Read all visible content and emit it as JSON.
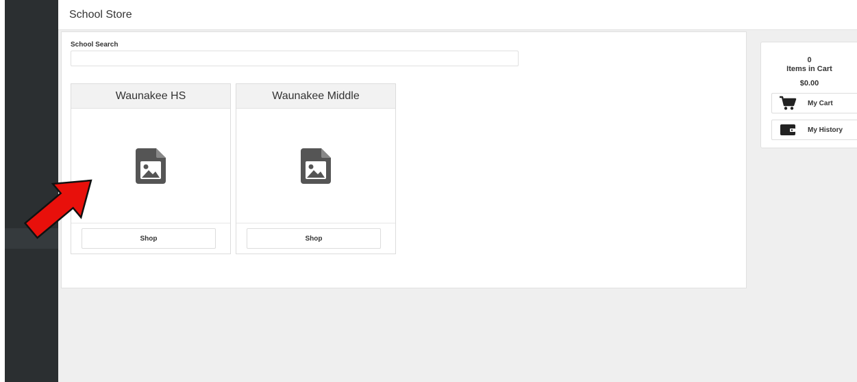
{
  "header": {
    "title": "School Store"
  },
  "search": {
    "label": "School Search",
    "value": "",
    "placeholder": ""
  },
  "schools": [
    {
      "name": "Waunakee HS",
      "button": "Shop",
      "image_icon": "image-file-icon"
    },
    {
      "name": "Waunakee Middle",
      "button": "Shop",
      "image_icon": "image-file-icon"
    }
  ],
  "cart": {
    "count": "0",
    "label": "Items in Cart",
    "total": "$0.00",
    "my_cart": "My Cart",
    "my_history": "My History"
  },
  "annotation": {
    "icon": "red-arrow-icon",
    "color": "#e8100b"
  },
  "colors": {
    "sidebar": "#2b2f31",
    "background": "#efefef",
    "icon_gray": "#555555"
  }
}
